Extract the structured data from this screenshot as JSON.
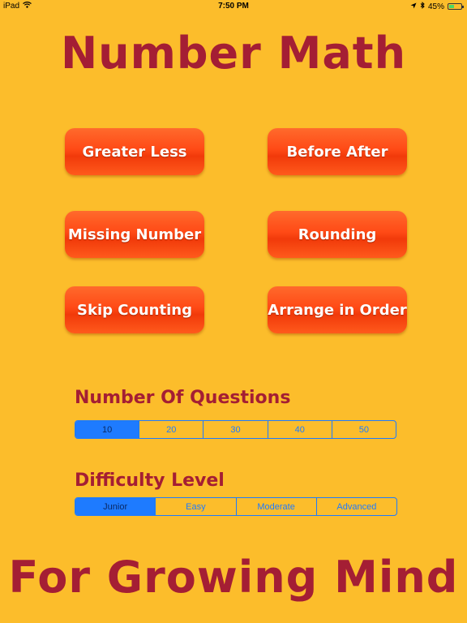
{
  "status_bar": {
    "device": "iPad",
    "time": "7:50 PM",
    "battery_percent_text": "45%",
    "battery_level": 0.45,
    "wifi_icon": "wifi-icon",
    "location_icon": "location-arrow-icon",
    "bluetooth_icon": "bluetooth-icon"
  },
  "app": {
    "title": "Number Math",
    "subtitle": "For Growing Mind"
  },
  "games": {
    "greater_less": "Greater Less",
    "before_after": "Before After",
    "missing_number": "Missing Number",
    "rounding": "Rounding",
    "skip_counting": "Skip Counting",
    "arrange_in_order": "Arrange in Order"
  },
  "questions": {
    "label": "Number Of Questions",
    "options": [
      "10",
      "20",
      "30",
      "40",
      "50"
    ],
    "selected": "10"
  },
  "difficulty": {
    "label": "Difficulty Level",
    "options": [
      "Junior",
      "Easy",
      "Moderate",
      "Advanced"
    ],
    "selected": "Junior"
  },
  "colors": {
    "background": "#FCBD2B",
    "title": "#A41E34",
    "button": "#FF4A16",
    "segment_accent": "#1E7BFF"
  }
}
